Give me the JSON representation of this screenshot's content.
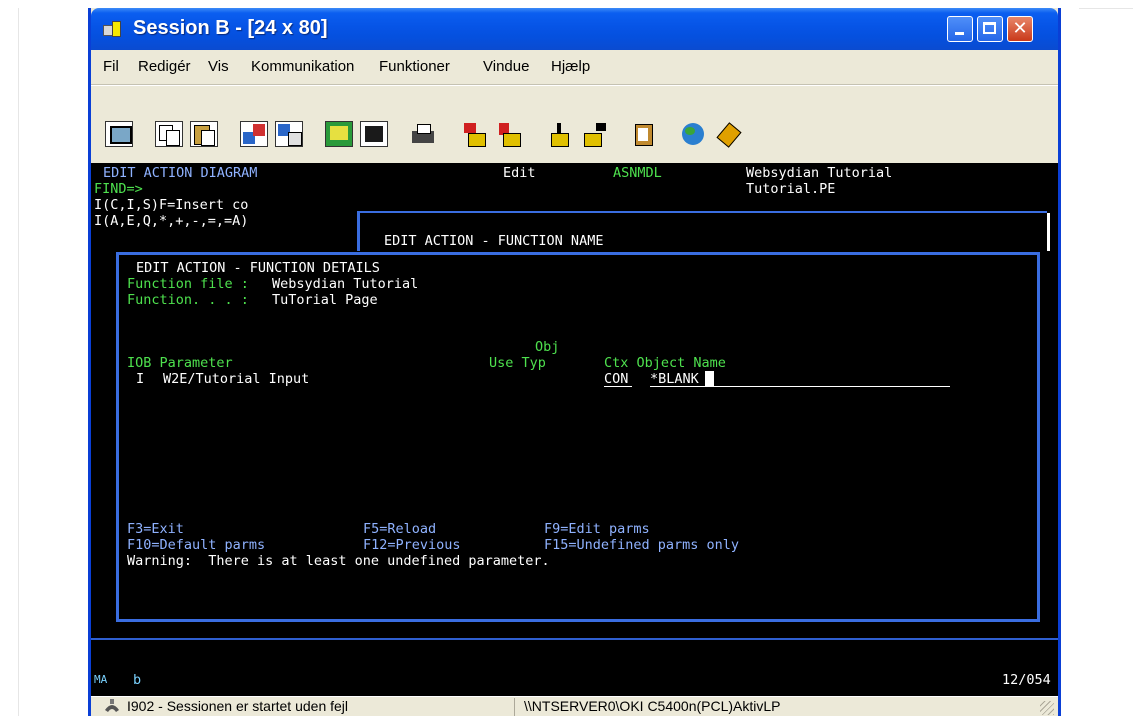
{
  "window": {
    "title": "Session B - [24 x 80]"
  },
  "menu": [
    "Fil",
    "Redigér",
    "Vis",
    "Kommunikation",
    "Funktioner",
    "Vindue",
    "Hjælp"
  ],
  "toolbar": {
    "icons": [
      "display-icon",
      "copy-icon",
      "paste-icon",
      "send-icon",
      "receive-icon",
      "screen-icon",
      "record-icon",
      "print-icon",
      "play-macro-icon",
      "stop-macro-icon",
      "start-recording-icon",
      "stop-recording-icon",
      "clipboard-icon",
      "globe-icon",
      "help-icon"
    ]
  },
  "terminal": {
    "header": {
      "title": "EDIT ACTION DIAGRAM",
      "mode": "Edit",
      "model": "ASNMDL",
      "context1": "Websydian Tutorial",
      "context2": "Tutorial.PE",
      "find": "FIND=>",
      "insert_hint1": "I(C,I,S)F=Insert co",
      "insert_hint2": "I(A,E,Q,*,+,-,=,=A)"
    },
    "dialog_outer_title": "EDIT ACTION - FUNCTION NAME",
    "dialog": {
      "title": "EDIT ACTION - FUNCTION DETAILS",
      "function_file_label": "Function file :",
      "function_file_value": "Websydian Tutorial",
      "function_label": "Function. . . :",
      "function_value": "TuTorial Page",
      "col_obj": "Obj",
      "col_iob_param": "IOB Parameter",
      "col_use_typ": "Use Typ",
      "col_ctx_obj": "Ctx Object Name",
      "row_iob": "I",
      "row_param": "W2E/Tutorial Input",
      "row_ctx": "CON",
      "row_object": "*BLANK",
      "fkeys_line1": [
        "F3=Exit",
        "F5=Reload",
        "F9=Edit parms"
      ],
      "fkeys_line2": [
        "F10=Default parms",
        "F12=Previous",
        "F15=Undefined parms only"
      ],
      "warning": "Warning:  There is at least one undefined parameter."
    },
    "oia": {
      "indicator": "MA",
      "session": "b",
      "position": "12/054"
    }
  },
  "status": {
    "message": "I902 - Sessionen er startet uden fejl",
    "printer": "\\\\NTSERVER0\\OKI C5400n(PCL)AktivLP"
  }
}
